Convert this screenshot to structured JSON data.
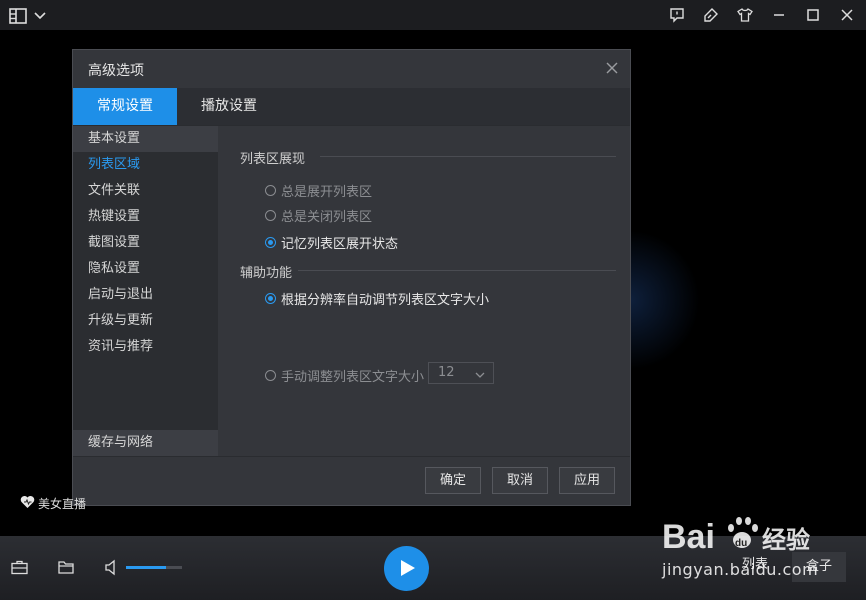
{
  "dialog": {
    "title": "高级选项",
    "tabs": [
      {
        "label": "常规设置",
        "active": true
      },
      {
        "label": "播放设置",
        "active": false
      }
    ],
    "sidebar": {
      "items": [
        {
          "label": "基本设置"
        },
        {
          "label": "列表区域"
        },
        {
          "label": "文件关联"
        },
        {
          "label": "热键设置"
        },
        {
          "label": "截图设置"
        },
        {
          "label": "隐私设置"
        },
        {
          "label": "启动与退出"
        },
        {
          "label": "升级与更新"
        },
        {
          "label": "资讯与推荐"
        }
      ],
      "bottom_item": "缓存与网络"
    },
    "section1": {
      "title": "列表区展现",
      "options": [
        {
          "label": "总是展开列表区",
          "selected": false
        },
        {
          "label": "总是关闭列表区",
          "selected": false
        },
        {
          "label": "记忆列表区展开状态",
          "selected": true
        }
      ]
    },
    "section2": {
      "title": "辅助功能",
      "options": [
        {
          "label": "根据分辨率自动调节列表区文字大小",
          "selected": true
        },
        {
          "label": "手动调整列表区文字大小",
          "selected": false
        }
      ],
      "font_size_value": "12"
    },
    "buttons": {
      "ok": "确定",
      "cancel": "取消",
      "apply": "应用"
    }
  },
  "live_badge": "美女直播",
  "bottom": {
    "volume_level": 0.72,
    "list_label": "列表",
    "box_label": "盒子"
  },
  "watermark": {
    "brand": "Bai",
    "brand_tail": "du",
    "cn": "经验",
    "url": "jingyan.baidu.com"
  },
  "colors": {
    "accent": "#1e8fe8",
    "dialog_bg": "#34363b",
    "sidebar_bg": "#2b2d31"
  }
}
